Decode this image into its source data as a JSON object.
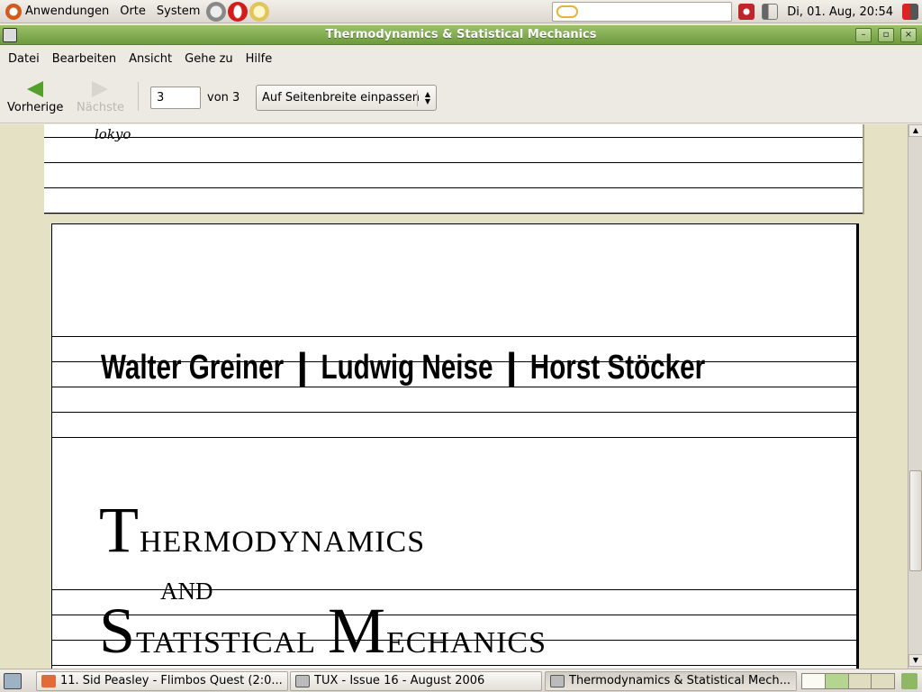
{
  "top_panel": {
    "menu_applications": "Anwendungen",
    "menu_places": "Orte",
    "menu_system": "System",
    "clock": "Di, 01. Aug, 20:54"
  },
  "window": {
    "title": "Thermodynamics & Statistical Mechanics"
  },
  "menubar": {
    "file": "Datei",
    "edit": "Bearbeiten",
    "view": "Ansicht",
    "go": "Gehe zu",
    "help": "Hilfe"
  },
  "toolbar": {
    "prev_label": "Vorherige",
    "next_label": "Nächste",
    "page_value": "3",
    "page_of": "von 3",
    "zoom_value": "Auf Seitenbreite einpassen"
  },
  "document": {
    "prev_page_text": "lokyo",
    "authors": "Walter Greiner  ❙  Ludwig Neise  ❙  Horst Stöcker",
    "title_line1_first": "T",
    "title_line1_rest": "hermodynamics",
    "title_and": "and",
    "title_line3_first": "S",
    "title_line3_mid": "tatistical ",
    "title_line3_m": "M",
    "title_line3_rest": "echanics"
  },
  "taskbar": {
    "tasks": [
      {
        "label": "11. Sid Peasley - Flimbos Quest (2:0...",
        "icon_color": "#e06a3a"
      },
      {
        "label": "TUX - Issue 16 - August 2006",
        "icon_color": "#9a9a9a"
      },
      {
        "label": "Thermodynamics & Statistical Mech...",
        "icon_color": "#9a9a9a"
      }
    ]
  },
  "colors": {
    "titlebar_green": "#7ca64a",
    "viewport_bg": "#e5e1c5",
    "accent_arrow": "#55a02c"
  }
}
